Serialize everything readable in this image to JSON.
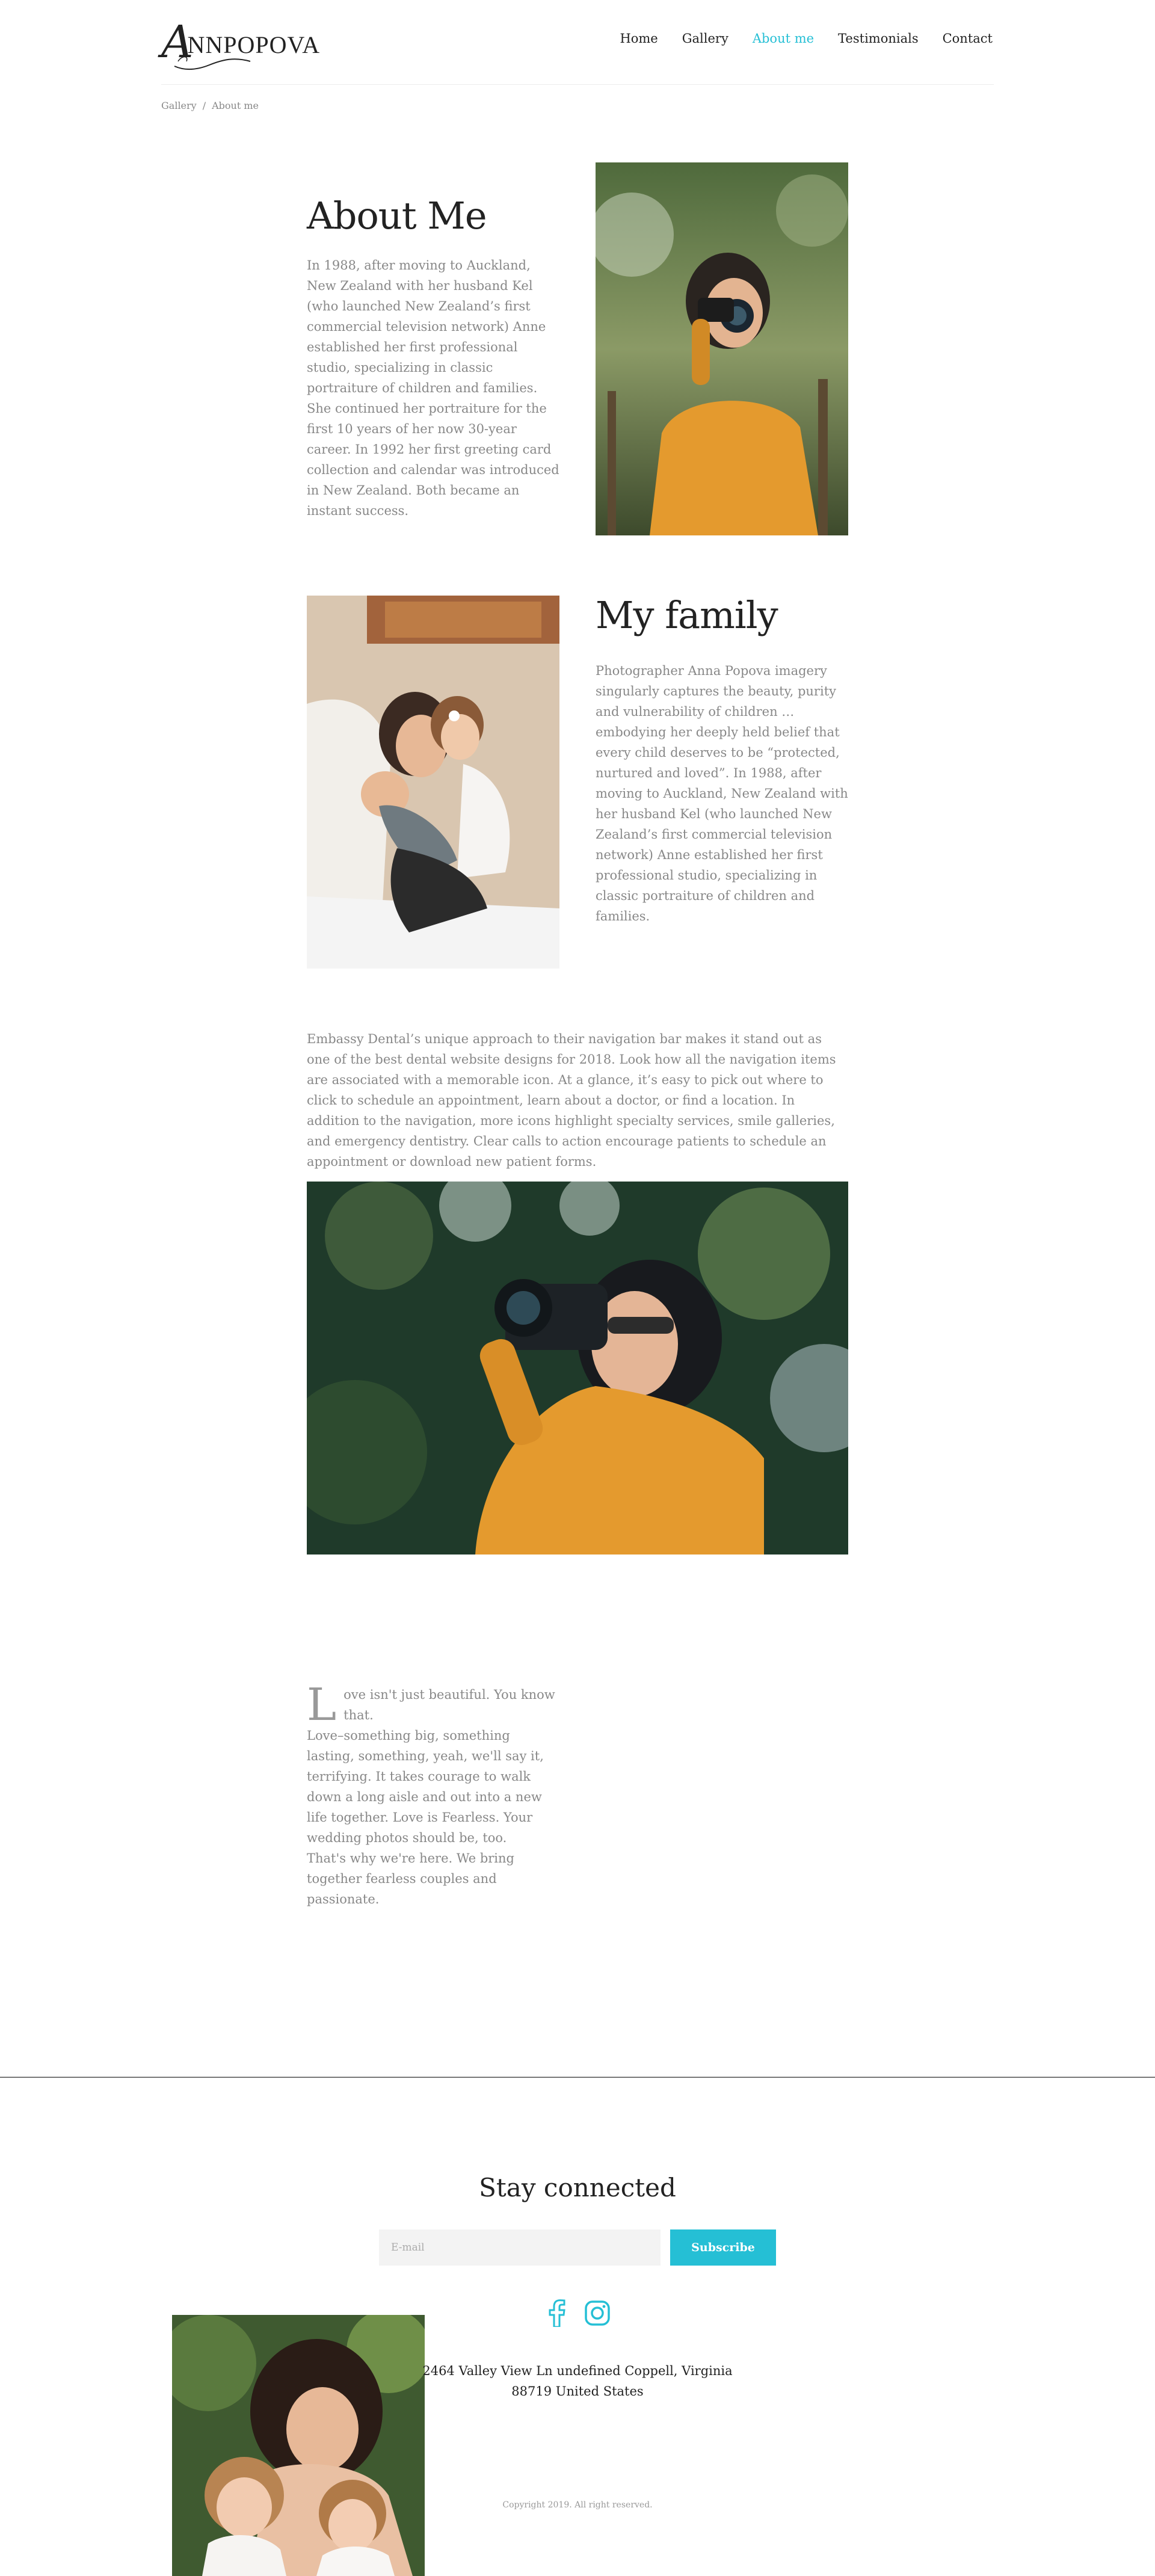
{
  "header": {
    "logo_initial": "A",
    "logo_word": "NNPOPOVA",
    "nav": [
      "Home",
      "Gallery",
      "About me",
      "Testimonials",
      "Contact"
    ],
    "active_nav": "About me"
  },
  "breadcrumb": {
    "parent": "Gallery",
    "separator": "/",
    "current": "About me"
  },
  "about": {
    "title": "About Me",
    "text": "In 1988, after moving to Auckland, New Zealand with her husband Kel (who launched New Zealand’s first commercial television network) Anne established her first professional studio, specializing in classic portraiture of children and families.  She continued her portraiture for the first 10 years of her now 30-year career.  In 1992 her first greeting card collection and calendar was introduced in New Zealand. Both became an instant success."
  },
  "family": {
    "title": "My family",
    "text": "Photographer Anna Popova imagery singularly captures the beauty, purity and vulnerability of children … embodying her deeply held belief that every child deserves to be “protected, nurtured and loved”. In 1988, after moving to Auckland, New Zealand with her husband Kel (who launched New Zealand’s first commercial television network) Anne established her first professional studio, specializing in classic portraiture of children and families."
  },
  "embassy": {
    "text": "Embassy Dental’s unique approach to their navigation bar makes it stand out as one of the best dental website designs for 2018. Look how all the navigation items are associated with a memorable icon. At a glance, it’s easy to pick out where to click to schedule an appointment, learn about a doctor, or find a location. In addition to the navigation, more icons highlight specialty services, smile galleries, and emergency dentistry. Clear calls to action encourage patients to schedule an appointment or download new patient forms."
  },
  "love": {
    "cap": "L",
    "line1": "ove isn't just beautiful. You know that.",
    "line2": "Love–something big, something lasting, something, yeah, we'll say it, terrifying. It takes courage to walk down a long aisle and out into a new life together. Love is Fearless. Your wedding photos should be, too.",
    "line3": "That's why we're here. We bring together fearless couples and passionate."
  },
  "footer": {
    "title": "Stay connected",
    "email_placeholder": "E-mail",
    "subscribe": "Subscribe",
    "address": "2464 Valley View Ln undefined Coppell, Virginia 88719 United States",
    "copyright": "Copyright 2019. All right reserved."
  },
  "colors": {
    "accent": "#25bfd5",
    "heading": "#222222",
    "body_text": "#888888"
  },
  "icons": [
    "facebook-icon",
    "instagram-icon"
  ]
}
